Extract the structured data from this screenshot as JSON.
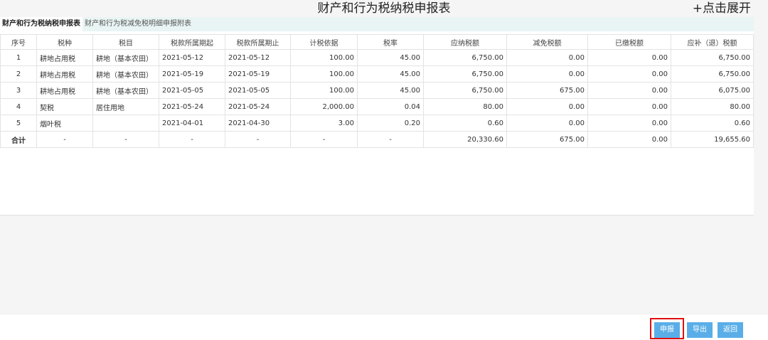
{
  "header": {
    "title": "财产和行为税纳税申报表",
    "expand_label": "+点击展开"
  },
  "tabs": [
    {
      "label": "财产和行为税纳税申报表"
    },
    {
      "label": "财产和行为税减免税明细申报附表"
    }
  ],
  "table": {
    "columns": [
      "序号",
      "税种",
      "税目",
      "税款所属期起",
      "税款所属期止",
      "计税依据",
      "税率",
      "应纳税额",
      "减免税额",
      "已缴税额",
      "应补（退）税额"
    ],
    "rows": [
      [
        "1",
        "耕地占用税",
        "耕地（基本农田）",
        "2021-05-12",
        "2021-05-12",
        "100.00",
        "45.00",
        "6,750.00",
        "0.00",
        "0.00",
        "6,750.00"
      ],
      [
        "2",
        "耕地占用税",
        "耕地（基本农田）",
        "2021-05-19",
        "2021-05-19",
        "100.00",
        "45.00",
        "6,750.00",
        "0.00",
        "0.00",
        "6,750.00"
      ],
      [
        "3",
        "耕地占用税",
        "耕地（基本农田）",
        "2021-05-05",
        "2021-05-05",
        "100.00",
        "45.00",
        "6,750.00",
        "675.00",
        "0.00",
        "6,075.00"
      ],
      [
        "4",
        "契税",
        "居住用地",
        "2021-05-24",
        "2021-05-24",
        "2,000.00",
        "0.04",
        "80.00",
        "0.00",
        "0.00",
        "80.00"
      ],
      [
        "5",
        "烟叶税",
        "",
        "2021-04-01",
        "2021-04-30",
        "3.00",
        "0.20",
        "0.60",
        "0.00",
        "0.00",
        "0.60"
      ]
    ],
    "total": [
      "合计",
      "-",
      "-",
      "-",
      "-",
      "-",
      "-",
      "20,330.60",
      "675.00",
      "0.00",
      "19,655.60"
    ]
  },
  "footer": {
    "submit_label": "申报",
    "export_label": "导出",
    "back_label": "返回"
  },
  "colors": {
    "button": "#5aaee8",
    "highlight": "#e01010",
    "tab_bar": "#e9f4f4"
  }
}
